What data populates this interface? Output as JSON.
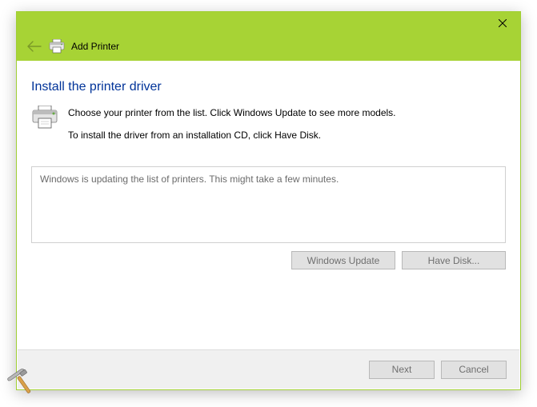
{
  "titlebar": {
    "title": "Add Printer"
  },
  "main": {
    "heading": "Install the printer driver",
    "instruction_line1": "Choose your printer from the list. Click Windows Update to see more models.",
    "instruction_line2": "To install the driver from an installation CD, click Have Disk.",
    "list_status": "Windows is updating the list of printers.  This might take a few minutes."
  },
  "buttons": {
    "windows_update": "Windows Update",
    "have_disk": "Have Disk...",
    "next": "Next",
    "cancel": "Cancel"
  }
}
